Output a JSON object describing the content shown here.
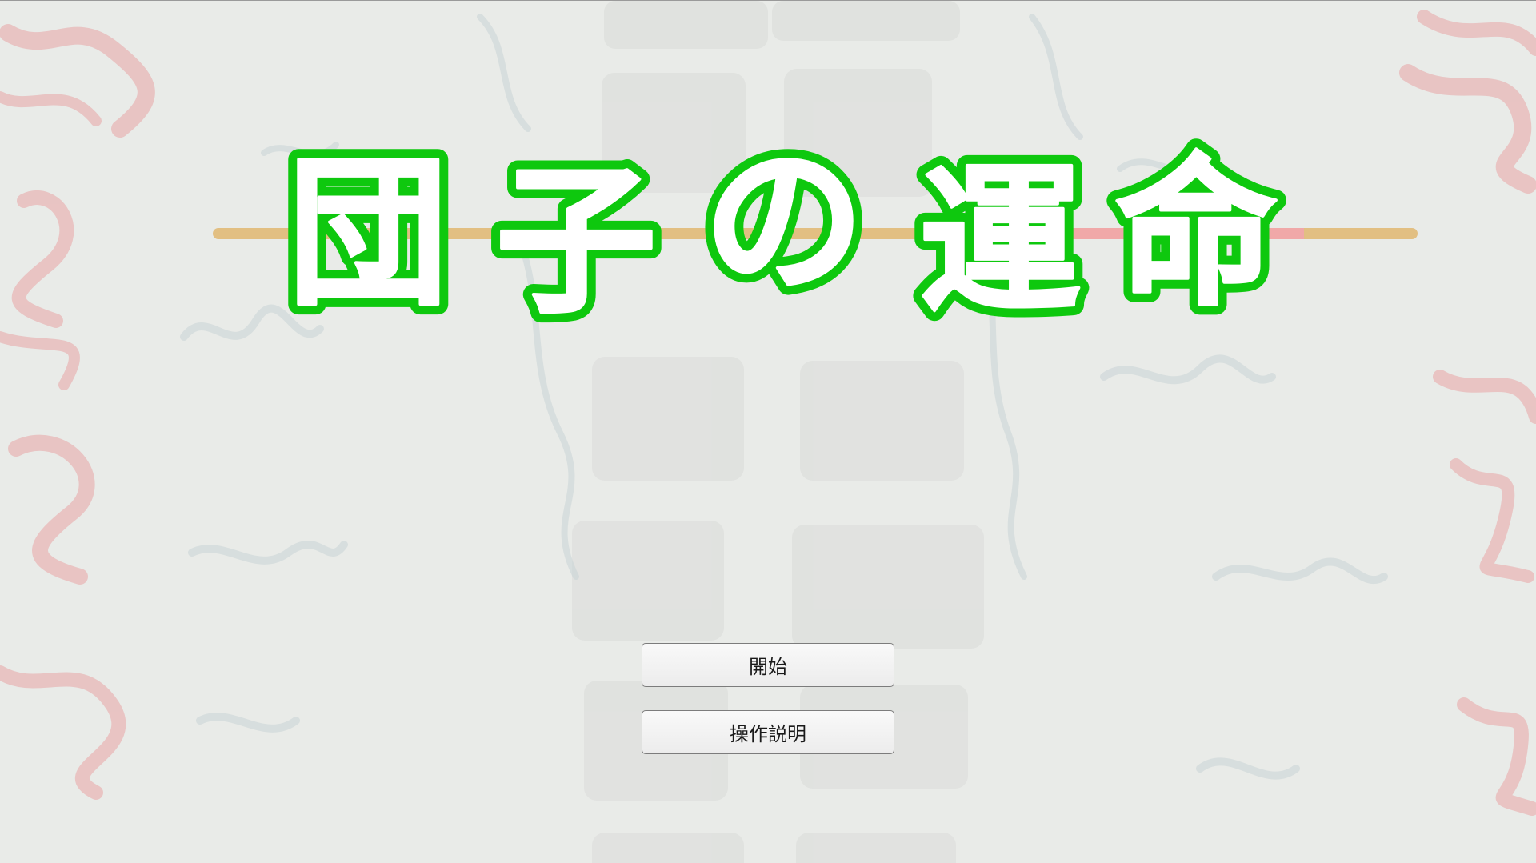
{
  "game": {
    "title_chars": [
      "団",
      "子",
      "の",
      "運",
      "命"
    ],
    "colors": {
      "background": "#e9ebe8",
      "title_outline": "#0ec80e",
      "title_fill": "#ffffff",
      "skewer": "#e2bf82",
      "skewer_highlight": "#f0a8a8",
      "brush_red": "#e8b4b4",
      "brush_gray": "#c9d3d6",
      "button_border": "#7c7c7c"
    }
  },
  "menu": {
    "start_label": "開始",
    "instructions_label": "操作説明"
  }
}
